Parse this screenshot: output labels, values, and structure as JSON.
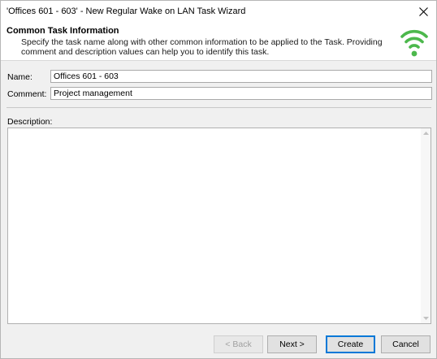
{
  "window": {
    "title": "'Offices 601 - 603' - New Regular Wake on LAN Task Wizard",
    "close_icon": "close-icon"
  },
  "header": {
    "title": "Common Task Information",
    "description": "Specify the task name along with other common information to be applied to the Task. Providing comment and description values can help you to identify this task.",
    "icon": "wifi-icon",
    "icon_color": "#4cb84c"
  },
  "form": {
    "name_label": "Name:",
    "name_value": "Offices 601 - 603",
    "comment_label": "Comment:",
    "comment_value": "Project management",
    "description_label": "Description:",
    "description_value": ""
  },
  "buttons": {
    "back": "< Back",
    "next": "Next >",
    "create": "Create",
    "cancel": "Cancel"
  },
  "colors": {
    "default_button_border": "#0078d7"
  }
}
